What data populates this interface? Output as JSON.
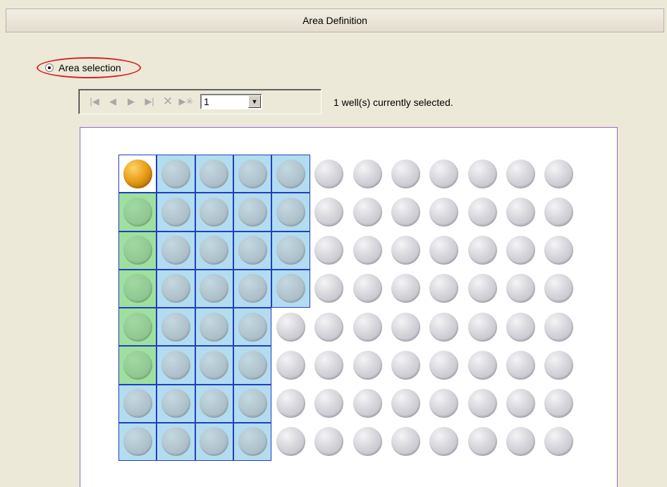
{
  "panel": {
    "title": "Area Definition"
  },
  "area_selection": {
    "label": "Area selection",
    "selected": true
  },
  "toolbar": {
    "first_icon": "first-record-icon",
    "prev_icon": "previous-record-icon",
    "next_icon": "next-record-icon",
    "last_icon": "last-record-icon",
    "delete_icon": "delete-icon",
    "new_icon": "new-record-icon",
    "area_number": "1",
    "status": "1 well(s) currently selected."
  },
  "plate": {
    "rows": 8,
    "columns": 12,
    "area_wells": [
      [
        0,
        0
      ],
      [
        0,
        1
      ],
      [
        0,
        2
      ],
      [
        0,
        3
      ],
      [
        0,
        4
      ],
      [
        1,
        0
      ],
      [
        1,
        1
      ],
      [
        1,
        2
      ],
      [
        1,
        3
      ],
      [
        1,
        4
      ],
      [
        2,
        0
      ],
      [
        2,
        1
      ],
      [
        2,
        2
      ],
      [
        2,
        3
      ],
      [
        2,
        4
      ],
      [
        3,
        0
      ],
      [
        3,
        1
      ],
      [
        3,
        2
      ],
      [
        3,
        3
      ],
      [
        3,
        4
      ],
      [
        4,
        0
      ],
      [
        4,
        1
      ],
      [
        4,
        2
      ],
      [
        4,
        3
      ],
      [
        5,
        0
      ],
      [
        5,
        1
      ],
      [
        5,
        2
      ],
      [
        5,
        3
      ],
      [
        6,
        0
      ],
      [
        6,
        1
      ],
      [
        6,
        2
      ],
      [
        6,
        3
      ],
      [
        7,
        0
      ],
      [
        7,
        1
      ],
      [
        7,
        2
      ],
      [
        7,
        3
      ]
    ],
    "green_wells": [
      [
        1,
        0
      ],
      [
        2,
        0
      ],
      [
        3,
        0
      ],
      [
        4,
        0
      ],
      [
        5,
        0
      ]
    ],
    "selected_wells": [
      [
        0,
        0
      ]
    ],
    "colors": {
      "area_fill": "#b3dcf0",
      "area_border": "#1f3fbd",
      "green_fill": "#a7e2a7",
      "selected_well": "#e59c11",
      "empty_well": "#d7d6dc"
    }
  }
}
